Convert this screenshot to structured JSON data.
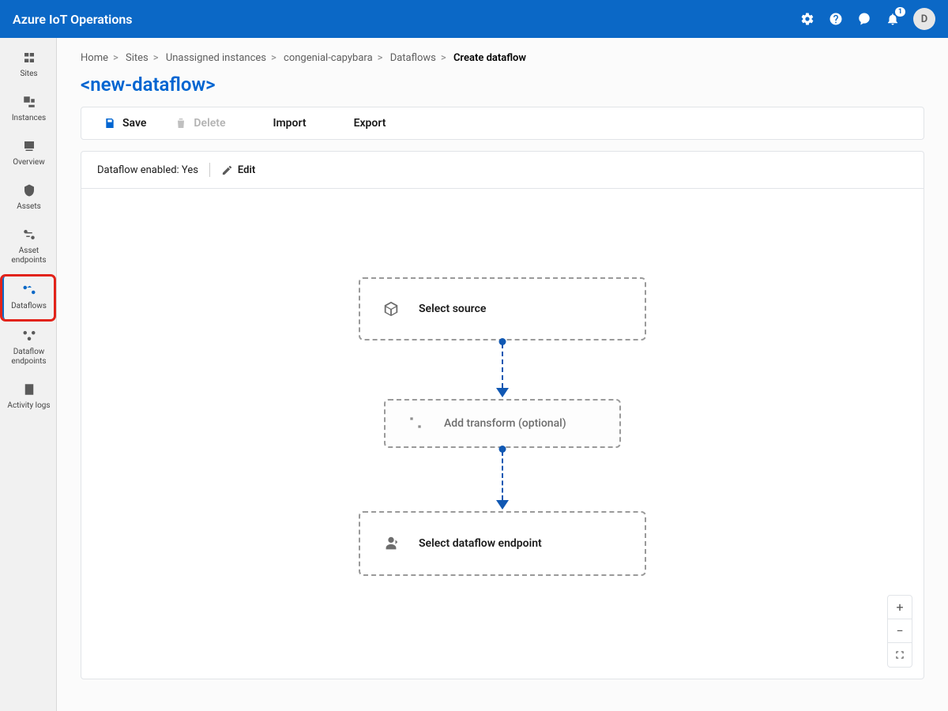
{
  "header": {
    "brand": "Azure IoT Operations",
    "notification_count": "1",
    "avatar_initial": "D"
  },
  "sidebar": {
    "items": [
      {
        "label": "Sites"
      },
      {
        "label": "Instances"
      },
      {
        "label": "Overview"
      },
      {
        "label": "Assets"
      },
      {
        "label": "Asset endpoints"
      },
      {
        "label": "Dataflows"
      },
      {
        "label": "Dataflow endpoints"
      },
      {
        "label": "Activity logs"
      }
    ]
  },
  "breadcrumb": {
    "items": [
      {
        "label": "Home"
      },
      {
        "label": "Sites"
      },
      {
        "label": "Unassigned instances"
      },
      {
        "label": "congenial-capybara"
      },
      {
        "label": "Dataflows"
      }
    ],
    "current": "Create dataflow"
  },
  "page": {
    "title": "<new-dataflow>"
  },
  "toolbar": {
    "save": "Save",
    "delete": "Delete",
    "import": "Import",
    "export": "Export"
  },
  "status": {
    "label": "Dataflow enabled: ",
    "value": "Yes",
    "edit": "Edit"
  },
  "flow": {
    "source": "Select source",
    "transform": "Add transform (optional)",
    "endpoint": "Select dataflow endpoint"
  }
}
